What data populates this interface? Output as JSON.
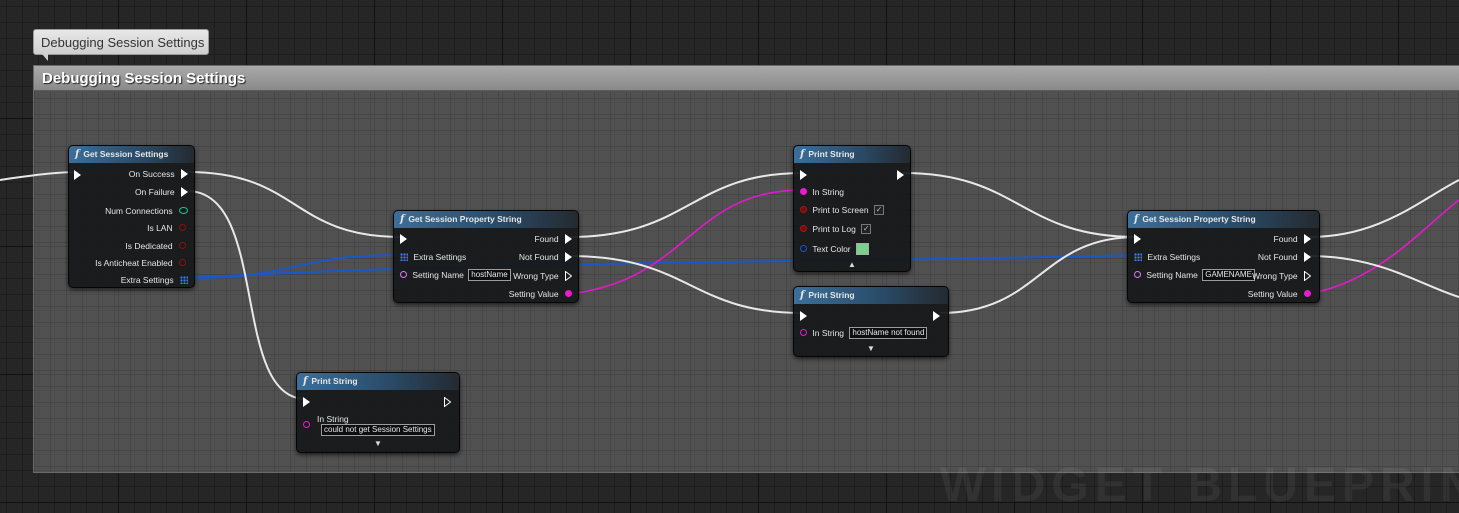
{
  "tooltip": {
    "text": "Debugging Session Settings"
  },
  "comment": {
    "title": "Debugging Session Settings"
  },
  "nodes": {
    "get_session_settings": {
      "title": "Get Session Settings",
      "outputs": [
        "On Success",
        "On Failure",
        "Num Connections",
        "Is LAN",
        "Is Dedicated",
        "Is Anticheat Enabled",
        "Extra Settings"
      ]
    },
    "get_prop_1": {
      "title": "Get Session Property String",
      "input_extra": "Extra Settings",
      "input_name": "Setting Name",
      "name_value": "hostName",
      "outputs": [
        "Found",
        "Not Found",
        "Wrong Type",
        "Setting Value"
      ]
    },
    "print_1": {
      "title": "Print String",
      "in_string": "In String",
      "print_to_screen": "Print to Screen",
      "print_to_log": "Print to Log",
      "text_color": "Text Color"
    },
    "print_2": {
      "title": "Print String",
      "in_string": "In String",
      "in_string_value": "hostName not found"
    },
    "get_prop_2": {
      "title": "Get Session Property String",
      "input_extra": "Extra Settings",
      "input_name": "Setting Name",
      "name_value": "GAMENAME",
      "outputs": [
        "Found",
        "Not Found",
        "Wrong Type",
        "Setting Value"
      ]
    },
    "print_3": {
      "title": "Print String",
      "in_string": "In String",
      "in_string_value": "could not get Session Settings"
    }
  },
  "icons": {
    "function": "function-icon",
    "exec": "exec-pin-icon",
    "expand": "expand-arrow-icon",
    "collapse": "collapse-arrow-icon"
  },
  "colors": {
    "exec_wire": "#e8e8e8",
    "string_wire": "#e21ac9",
    "struct_wire": "#1a57c8",
    "header_blue": "#3b6f9a"
  }
}
